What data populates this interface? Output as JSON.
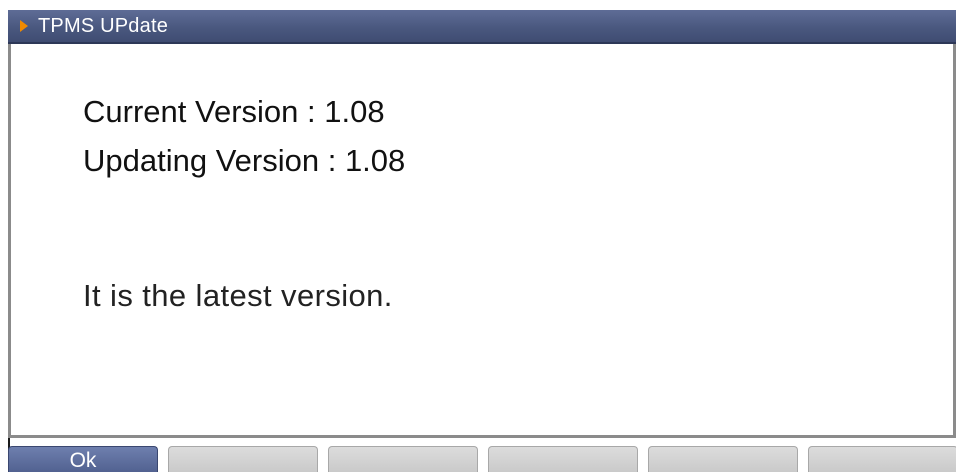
{
  "window": {
    "title": "TPMS UPdate"
  },
  "version_info": {
    "current_line": "Current Version : 1.08",
    "updating_line": "Updating Version : 1.08"
  },
  "status": {
    "message": "It is the latest version."
  },
  "softkeys": [
    {
      "label": "Ok"
    },
    {
      "label": ""
    },
    {
      "label": ""
    },
    {
      "label": ""
    },
    {
      "label": ""
    },
    {
      "label": ""
    }
  ],
  "colors": {
    "title_bar": "#4a587f",
    "title_arrow": "#f08a00",
    "active_softkey": "#5a6a99",
    "inactive_softkey": "#cfcfcf"
  }
}
